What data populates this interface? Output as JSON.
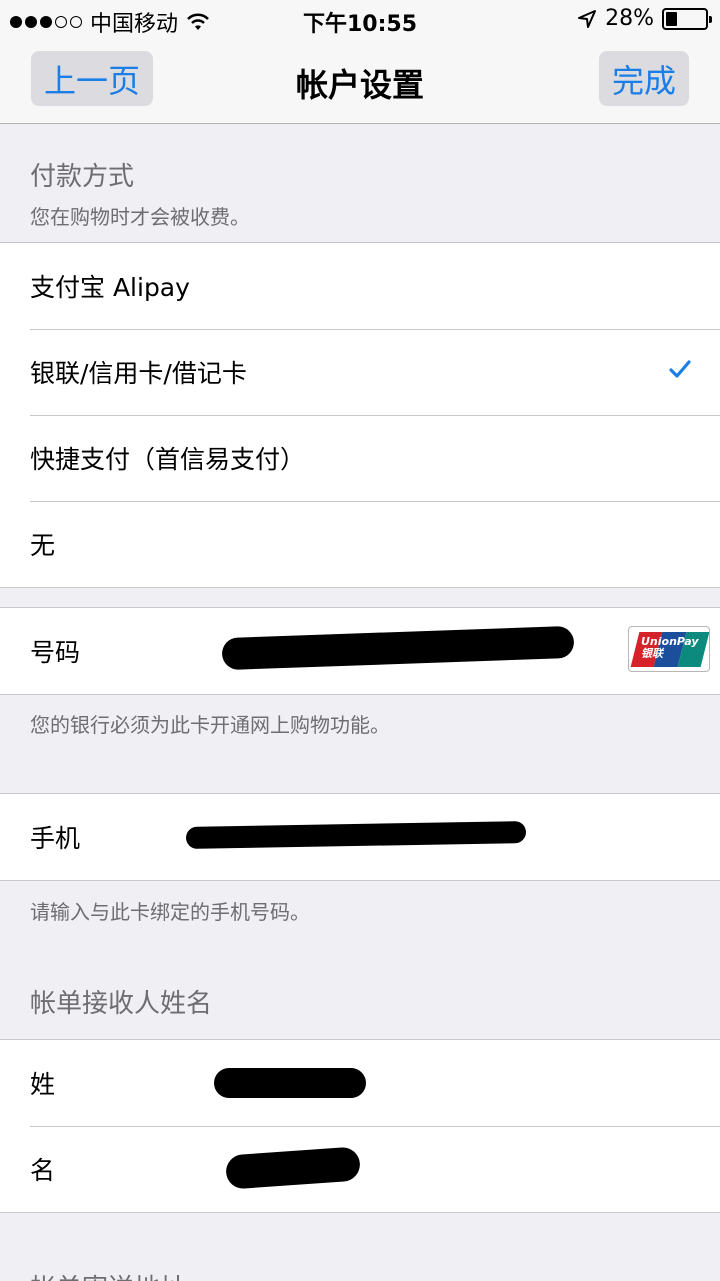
{
  "status_bar": {
    "carrier": "中国移动",
    "time": "下午10:55",
    "battery": "28%",
    "battery_level": 0.28
  },
  "nav": {
    "back_label": "上一页",
    "title": "帐户设置",
    "done_label": "完成"
  },
  "payment_section": {
    "title": "付款方式",
    "subtitle": "您在购物时才会被收费。",
    "options": [
      {
        "label": "支付宝 Alipay",
        "selected": false
      },
      {
        "label": "银联/信用卡/借记卡",
        "selected": true
      },
      {
        "label": "快捷支付（首信易支付）",
        "selected": false
      },
      {
        "label": "无",
        "selected": false
      }
    ]
  },
  "card": {
    "number_label": "号码",
    "card_logo": "UnionPay 银联",
    "note": "您的银行必须为此卡开通网上购物功能。"
  },
  "phone": {
    "label": "手机",
    "note": "请输入与此卡绑定的手机号码。"
  },
  "billing_name": {
    "title": "帐单接收人姓名",
    "last_name_label": "姓",
    "first_name_label": "名"
  },
  "billing_address": {
    "title": "帐单寄送地址"
  },
  "colors": {
    "accent": "#1a7ee6",
    "background": "#efeff4",
    "separator": "#c8c7cc"
  }
}
